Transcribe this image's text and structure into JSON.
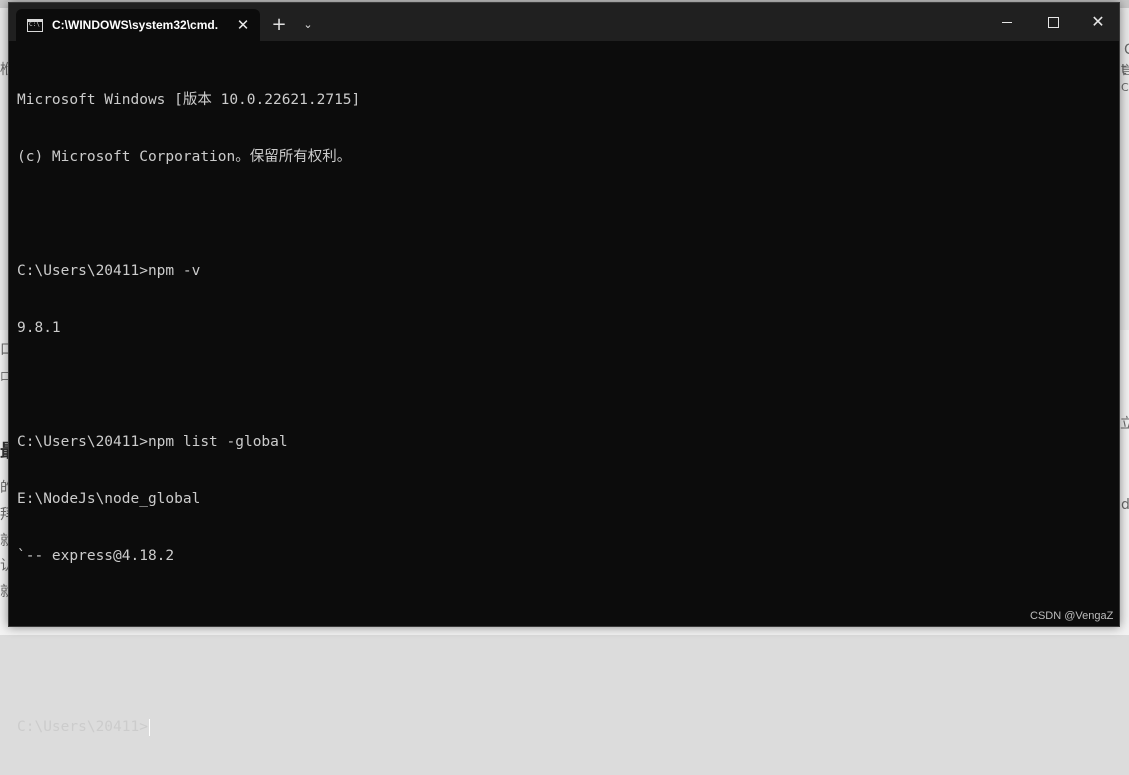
{
  "background": {
    "fragments": [
      "栿",
      "t",
      "C",
      "言",
      "口",
      "口",
      "立",
      "最",
      "的",
      "拜",
      "就",
      "认",
      "就",
      "d",
      "C"
    ]
  },
  "window": {
    "tab_title": "C:\\WINDOWS\\system32\\cmd.",
    "tab_icon": "cmd-icon",
    "tab_close": "✕",
    "new_tab": "+",
    "dropdown": "⌄",
    "minimize_icon": "minimize-icon",
    "maximize_icon": "maximize-icon",
    "close": "✕"
  },
  "console": {
    "lines": [
      "Microsoft Windows [版本 10.0.22621.2715]",
      "(c) Microsoft Corporation。保留所有权利。",
      "",
      "C:\\Users\\20411>npm -v",
      "9.8.1",
      "",
      "C:\\Users\\20411>npm list -global",
      "E:\\NodeJs\\node_global",
      "`-- express@4.18.2",
      "",
      ""
    ],
    "prompt": "C:\\Users\\20411>"
  },
  "watermark": "CSDN @VengaZ",
  "colors": {
    "terminal_bg": "#0c0c0c",
    "titlebar_bg": "#202020",
    "text": "#cccccc"
  }
}
